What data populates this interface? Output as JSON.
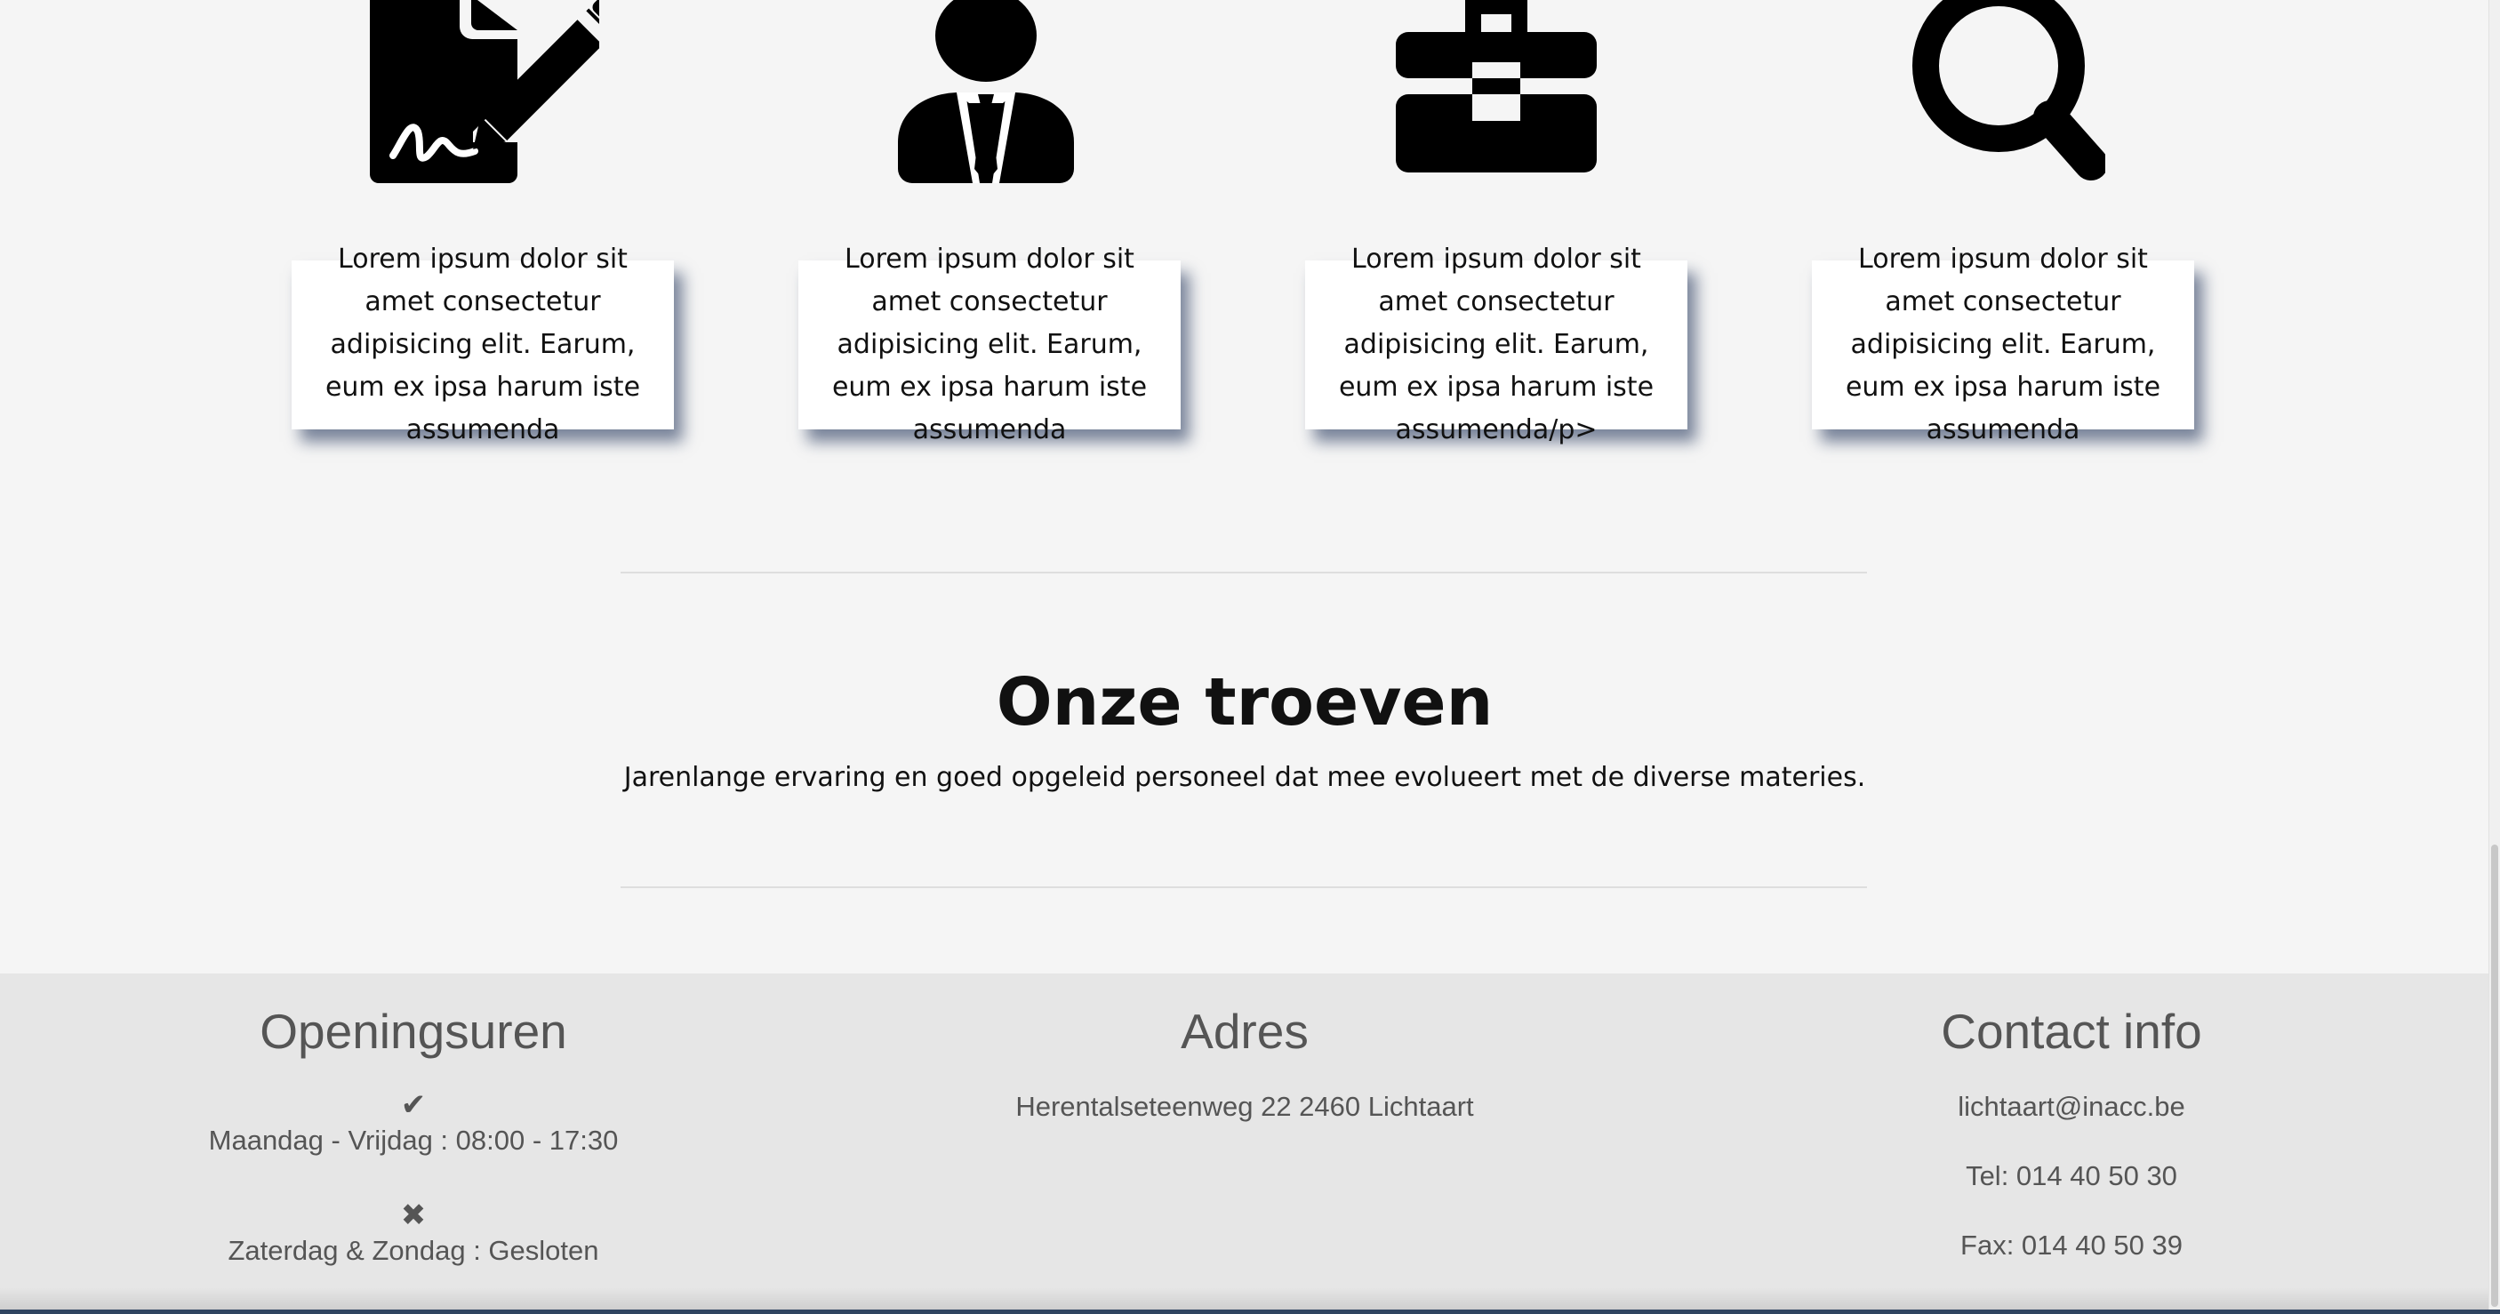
{
  "features": [
    {
      "icon": "contract-sign-icon",
      "text": "Lorem ipsum dolor sit amet consectetur adipisicing elit. Earum, eum ex ipsa harum iste assumenda"
    },
    {
      "icon": "businessman-icon",
      "text": "Lorem ipsum dolor sit amet consectetur adipisicing elit. Earum, eum ex ipsa harum iste assumenda"
    },
    {
      "icon": "briefcase-icon",
      "text": "Lorem ipsum dolor sit amet consectetur adipisicing elit. Earum, eum ex ipsa harum iste assumenda/p>"
    },
    {
      "icon": "search-icon",
      "text": "Lorem ipsum dolor sit amet consectetur adipisicing elit. Earum, eum ex ipsa harum iste assumenda"
    }
  ],
  "troeven": {
    "title": "Onze troeven",
    "text": "Jarenlange ervaring en goed opgeleid personeel dat mee evolueert met de diverse materies."
  },
  "footer": {
    "openingsuren": {
      "title": "Openingsuren",
      "open_icon": "check-icon",
      "open_text": "Maandag - Vrijdag : 08:00 - 17:30",
      "closed_icon": "close-icon",
      "closed_text": "Zaterdag & Zondag : Gesloten"
    },
    "adres": {
      "title": "Adres",
      "address": "Herentalseteenweg 22 2460 Lichtaart"
    },
    "contact": {
      "title": "Contact info",
      "email": "lichtaart@inacc.be",
      "tel": "Tel: 014 40 50 30",
      "fax": "Fax: 014 40 50 39"
    }
  },
  "colors": {
    "background": "#f5f5f5",
    "footer_background": "#e6e6e6",
    "footer_text": "#555555",
    "card_shadow": "#14284f"
  }
}
